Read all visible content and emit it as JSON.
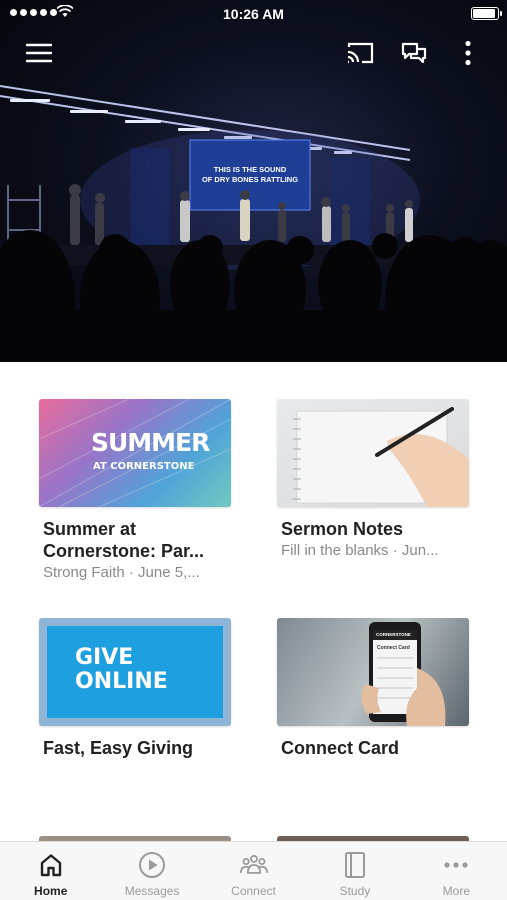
{
  "status_bar": {
    "time": "10:26 AM",
    "battery_level": 0.9
  },
  "hero": {
    "screen_text_line1": "THIS IS THE SOUND",
    "screen_text_line2": "OF DRY BONES RATTLING"
  },
  "cards": [
    {
      "title_line1": "Summer at",
      "title_line2": "Cornerstone: Par...",
      "subtitle": "Strong Faith · June 5,...",
      "thumb_title": "SUMMER",
      "thumb_sub": "AT CORNERSTONE"
    },
    {
      "title_line1": "Sermon Notes",
      "subtitle": "Fill in the blanks · Jun..."
    },
    {
      "title_line1": "Fast, Easy Giving",
      "thumb_line1": "GIVE",
      "thumb_line2": "ONLINE"
    },
    {
      "title_line1": "Connect Card",
      "thumb_label": "CORNERSTONE",
      "thumb_form_title": "Connect Card"
    }
  ],
  "tabs": [
    {
      "label": "Home",
      "icon": "home-icon",
      "active": true
    },
    {
      "label": "Messages",
      "icon": "play-circle-icon"
    },
    {
      "label": "Connect",
      "icon": "people-icon"
    },
    {
      "label": "Study",
      "icon": "book-icon"
    },
    {
      "label": "More",
      "icon": "more-dots-icon"
    }
  ],
  "colors": {
    "active_tab": "#222222",
    "inactive_tab": "#9a9a9a",
    "hero_dark": "#0c0f1e"
  }
}
